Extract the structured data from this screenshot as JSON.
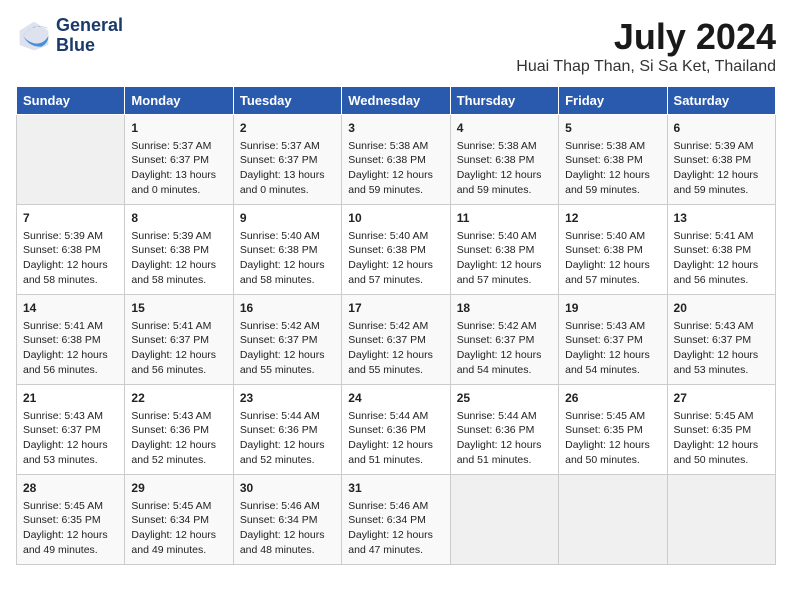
{
  "header": {
    "logo_line1": "General",
    "logo_line2": "Blue",
    "month": "July 2024",
    "location": "Huai Thap Than, Si Sa Ket, Thailand"
  },
  "weekdays": [
    "Sunday",
    "Monday",
    "Tuesday",
    "Wednesday",
    "Thursday",
    "Friday",
    "Saturday"
  ],
  "weeks": [
    [
      {
        "day": "",
        "sunrise": "",
        "sunset": "",
        "daylight": ""
      },
      {
        "day": "1",
        "sunrise": "Sunrise: 5:37 AM",
        "sunset": "Sunset: 6:37 PM",
        "daylight": "Daylight: 13 hours and 0 minutes."
      },
      {
        "day": "2",
        "sunrise": "Sunrise: 5:37 AM",
        "sunset": "Sunset: 6:37 PM",
        "daylight": "Daylight: 13 hours and 0 minutes."
      },
      {
        "day": "3",
        "sunrise": "Sunrise: 5:38 AM",
        "sunset": "Sunset: 6:38 PM",
        "daylight": "Daylight: 12 hours and 59 minutes."
      },
      {
        "day": "4",
        "sunrise": "Sunrise: 5:38 AM",
        "sunset": "Sunset: 6:38 PM",
        "daylight": "Daylight: 12 hours and 59 minutes."
      },
      {
        "day": "5",
        "sunrise": "Sunrise: 5:38 AM",
        "sunset": "Sunset: 6:38 PM",
        "daylight": "Daylight: 12 hours and 59 minutes."
      },
      {
        "day": "6",
        "sunrise": "Sunrise: 5:39 AM",
        "sunset": "Sunset: 6:38 PM",
        "daylight": "Daylight: 12 hours and 59 minutes."
      }
    ],
    [
      {
        "day": "7",
        "sunrise": "Sunrise: 5:39 AM",
        "sunset": "Sunset: 6:38 PM",
        "daylight": "Daylight: 12 hours and 58 minutes."
      },
      {
        "day": "8",
        "sunrise": "Sunrise: 5:39 AM",
        "sunset": "Sunset: 6:38 PM",
        "daylight": "Daylight: 12 hours and 58 minutes."
      },
      {
        "day": "9",
        "sunrise": "Sunrise: 5:40 AM",
        "sunset": "Sunset: 6:38 PM",
        "daylight": "Daylight: 12 hours and 58 minutes."
      },
      {
        "day": "10",
        "sunrise": "Sunrise: 5:40 AM",
        "sunset": "Sunset: 6:38 PM",
        "daylight": "Daylight: 12 hours and 57 minutes."
      },
      {
        "day": "11",
        "sunrise": "Sunrise: 5:40 AM",
        "sunset": "Sunset: 6:38 PM",
        "daylight": "Daylight: 12 hours and 57 minutes."
      },
      {
        "day": "12",
        "sunrise": "Sunrise: 5:40 AM",
        "sunset": "Sunset: 6:38 PM",
        "daylight": "Daylight: 12 hours and 57 minutes."
      },
      {
        "day": "13",
        "sunrise": "Sunrise: 5:41 AM",
        "sunset": "Sunset: 6:38 PM",
        "daylight": "Daylight: 12 hours and 56 minutes."
      }
    ],
    [
      {
        "day": "14",
        "sunrise": "Sunrise: 5:41 AM",
        "sunset": "Sunset: 6:38 PM",
        "daylight": "Daylight: 12 hours and 56 minutes."
      },
      {
        "day": "15",
        "sunrise": "Sunrise: 5:41 AM",
        "sunset": "Sunset: 6:37 PM",
        "daylight": "Daylight: 12 hours and 56 minutes."
      },
      {
        "day": "16",
        "sunrise": "Sunrise: 5:42 AM",
        "sunset": "Sunset: 6:37 PM",
        "daylight": "Daylight: 12 hours and 55 minutes."
      },
      {
        "day": "17",
        "sunrise": "Sunrise: 5:42 AM",
        "sunset": "Sunset: 6:37 PM",
        "daylight": "Daylight: 12 hours and 55 minutes."
      },
      {
        "day": "18",
        "sunrise": "Sunrise: 5:42 AM",
        "sunset": "Sunset: 6:37 PM",
        "daylight": "Daylight: 12 hours and 54 minutes."
      },
      {
        "day": "19",
        "sunrise": "Sunrise: 5:43 AM",
        "sunset": "Sunset: 6:37 PM",
        "daylight": "Daylight: 12 hours and 54 minutes."
      },
      {
        "day": "20",
        "sunrise": "Sunrise: 5:43 AM",
        "sunset": "Sunset: 6:37 PM",
        "daylight": "Daylight: 12 hours and 53 minutes."
      }
    ],
    [
      {
        "day": "21",
        "sunrise": "Sunrise: 5:43 AM",
        "sunset": "Sunset: 6:37 PM",
        "daylight": "Daylight: 12 hours and 53 minutes."
      },
      {
        "day": "22",
        "sunrise": "Sunrise: 5:43 AM",
        "sunset": "Sunset: 6:36 PM",
        "daylight": "Daylight: 12 hours and 52 minutes."
      },
      {
        "day": "23",
        "sunrise": "Sunrise: 5:44 AM",
        "sunset": "Sunset: 6:36 PM",
        "daylight": "Daylight: 12 hours and 52 minutes."
      },
      {
        "day": "24",
        "sunrise": "Sunrise: 5:44 AM",
        "sunset": "Sunset: 6:36 PM",
        "daylight": "Daylight: 12 hours and 51 minutes."
      },
      {
        "day": "25",
        "sunrise": "Sunrise: 5:44 AM",
        "sunset": "Sunset: 6:36 PM",
        "daylight": "Daylight: 12 hours and 51 minutes."
      },
      {
        "day": "26",
        "sunrise": "Sunrise: 5:45 AM",
        "sunset": "Sunset: 6:35 PM",
        "daylight": "Daylight: 12 hours and 50 minutes."
      },
      {
        "day": "27",
        "sunrise": "Sunrise: 5:45 AM",
        "sunset": "Sunset: 6:35 PM",
        "daylight": "Daylight: 12 hours and 50 minutes."
      }
    ],
    [
      {
        "day": "28",
        "sunrise": "Sunrise: 5:45 AM",
        "sunset": "Sunset: 6:35 PM",
        "daylight": "Daylight: 12 hours and 49 minutes."
      },
      {
        "day": "29",
        "sunrise": "Sunrise: 5:45 AM",
        "sunset": "Sunset: 6:34 PM",
        "daylight": "Daylight: 12 hours and 49 minutes."
      },
      {
        "day": "30",
        "sunrise": "Sunrise: 5:46 AM",
        "sunset": "Sunset: 6:34 PM",
        "daylight": "Daylight: 12 hours and 48 minutes."
      },
      {
        "day": "31",
        "sunrise": "Sunrise: 5:46 AM",
        "sunset": "Sunset: 6:34 PM",
        "daylight": "Daylight: 12 hours and 47 minutes."
      },
      {
        "day": "",
        "sunrise": "",
        "sunset": "",
        "daylight": ""
      },
      {
        "day": "",
        "sunrise": "",
        "sunset": "",
        "daylight": ""
      },
      {
        "day": "",
        "sunrise": "",
        "sunset": "",
        "daylight": ""
      }
    ]
  ]
}
